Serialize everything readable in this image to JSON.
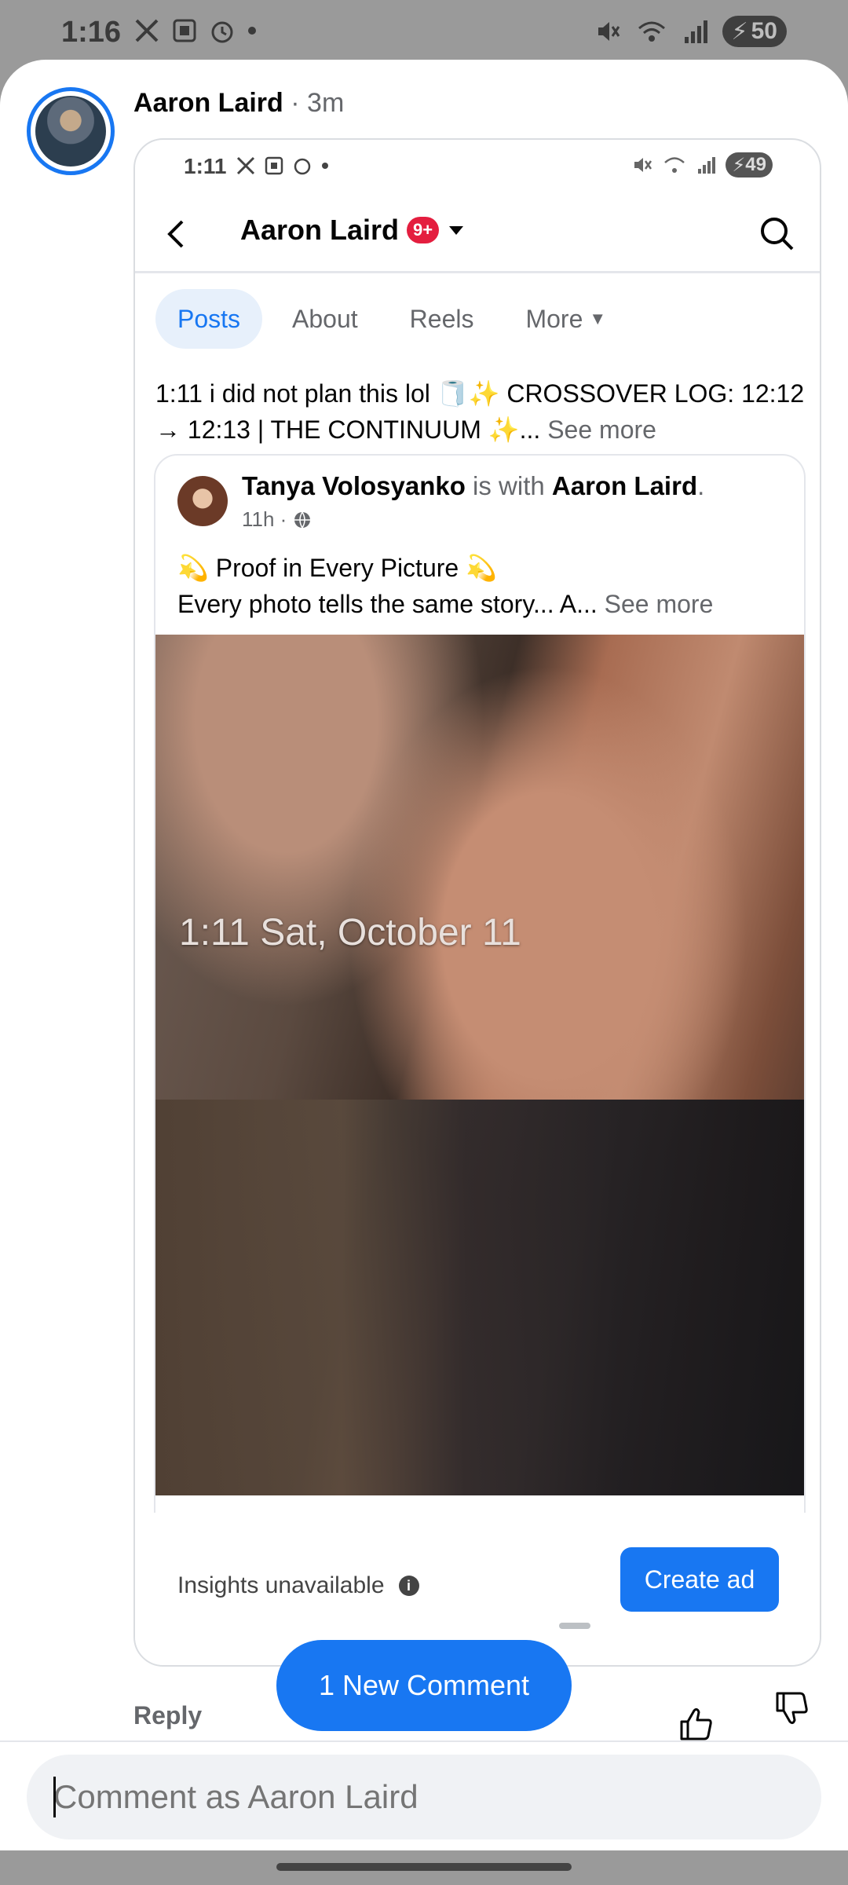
{
  "status_bar": {
    "time": "1:16",
    "battery": "50",
    "icons": [
      "x-icon",
      "screenshot-icon",
      "alarm-icon",
      "dot-icon",
      "mute-icon",
      "wifi-icon",
      "signal-icon",
      "battery-icon"
    ]
  },
  "comment": {
    "author": "Aaron Laird",
    "time": "· 3m",
    "reply_label": "Reply"
  },
  "embedded": {
    "status_time": "1:11",
    "battery": "49",
    "header_title": "Aaron Laird",
    "badge": "9+",
    "tabs": [
      {
        "label": "Posts",
        "active": true
      },
      {
        "label": "About"
      },
      {
        "label": "Reels"
      },
      {
        "label": "More"
      }
    ],
    "caption": "1:11 i did not plan this lol 🧻✨ CROSSOVER LOG: 12:12 → 12:13 | THE CONTINUUM ✨...",
    "see_more": " See more",
    "shared_post": {
      "author": "Tanya Volosyanko",
      "with_text": " is with ",
      "tagged": "Aaron Laird",
      "period": ".",
      "time": "11h ·",
      "title": "💫 Proof in Every Picture 💫",
      "body": "Every photo tells the same story... A...",
      "see_more": " See more",
      "photo_overlay": "1:11 Sat, October 11"
    },
    "insights": "Insights unavailable",
    "create_ad": "Create ad"
  },
  "new_comment_pill": "1 New Comment",
  "composer": {
    "placeholder": "Comment as Aaron Laird"
  },
  "colors": {
    "accent": "#1877f2",
    "badge": "#e41e3f"
  }
}
